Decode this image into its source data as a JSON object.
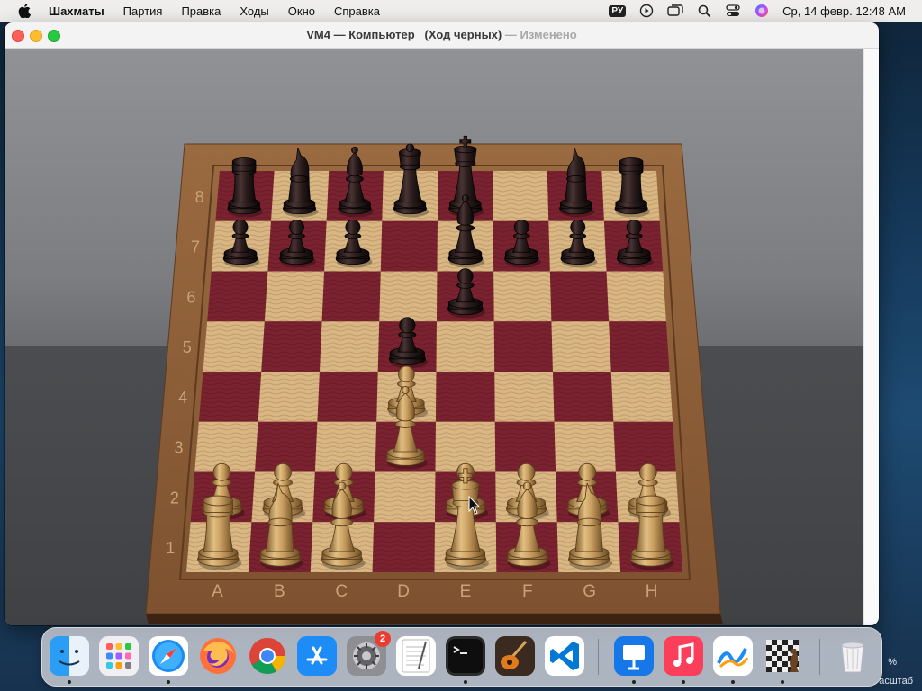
{
  "menubar": {
    "app_name": "Шахматы",
    "items": [
      "Партия",
      "Правка",
      "Ходы",
      "Окно",
      "Справка"
    ],
    "keyboard": "РУ",
    "clock": "Ср, 14 февр.  12:48 AM"
  },
  "window": {
    "title_main": "VM4 — Компьютер",
    "title_turn": "(Ход черных)",
    "title_sep": "—",
    "title_status": "Изменено"
  },
  "board": {
    "files": [
      "A",
      "B",
      "C",
      "D",
      "E",
      "F",
      "G",
      "H"
    ],
    "ranks": [
      "1",
      "2",
      "3",
      "4",
      "5",
      "6",
      "7",
      "8"
    ],
    "colors": {
      "dark_square": "#7a2230",
      "light_square": "#d9b98a",
      "frame": "#8a5a35",
      "white_piece": "#c9a265",
      "black_piece": "#2b1d1e"
    },
    "pieces": [
      {
        "square": "a8",
        "color": "black",
        "type": "rook"
      },
      {
        "square": "b8",
        "color": "black",
        "type": "knight"
      },
      {
        "square": "c8",
        "color": "black",
        "type": "bishop"
      },
      {
        "square": "d8",
        "color": "black",
        "type": "queen"
      },
      {
        "square": "e8",
        "color": "black",
        "type": "king"
      },
      {
        "square": "g8",
        "color": "black",
        "type": "knight"
      },
      {
        "square": "h8",
        "color": "black",
        "type": "rook"
      },
      {
        "square": "a7",
        "color": "black",
        "type": "pawn"
      },
      {
        "square": "b7",
        "color": "black",
        "type": "pawn"
      },
      {
        "square": "c7",
        "color": "black",
        "type": "pawn"
      },
      {
        "square": "e7",
        "color": "black",
        "type": "bishop"
      },
      {
        "square": "f7",
        "color": "black",
        "type": "pawn"
      },
      {
        "square": "g7",
        "color": "black",
        "type": "pawn"
      },
      {
        "square": "h7",
        "color": "black",
        "type": "pawn"
      },
      {
        "square": "e6",
        "color": "black",
        "type": "pawn"
      },
      {
        "square": "d5",
        "color": "black",
        "type": "pawn"
      },
      {
        "square": "d4",
        "color": "white",
        "type": "pawn"
      },
      {
        "square": "d3",
        "color": "white",
        "type": "bishop"
      },
      {
        "square": "a2",
        "color": "white",
        "type": "pawn"
      },
      {
        "square": "b2",
        "color": "white",
        "type": "pawn"
      },
      {
        "square": "c2",
        "color": "white",
        "type": "pawn"
      },
      {
        "square": "e2",
        "color": "white",
        "type": "pawn"
      },
      {
        "square": "f2",
        "color": "white",
        "type": "pawn"
      },
      {
        "square": "g2",
        "color": "white",
        "type": "pawn"
      },
      {
        "square": "h2",
        "color": "white",
        "type": "pawn"
      },
      {
        "square": "a1",
        "color": "white",
        "type": "rook"
      },
      {
        "square": "b1",
        "color": "white",
        "type": "knight"
      },
      {
        "square": "c1",
        "color": "white",
        "type": "bishop"
      },
      {
        "square": "e1",
        "color": "white",
        "type": "king"
      },
      {
        "square": "f1",
        "color": "white",
        "type": "bishop"
      },
      {
        "square": "g1",
        "color": "white",
        "type": "knight"
      },
      {
        "square": "h1",
        "color": "white",
        "type": "rook"
      }
    ]
  },
  "dock": {
    "apps": [
      {
        "name": "finder",
        "running": true
      },
      {
        "name": "launchpad",
        "running": false
      },
      {
        "name": "safari",
        "running": true
      },
      {
        "name": "firefox",
        "running": false
      },
      {
        "name": "chrome",
        "running": false
      },
      {
        "name": "app-store",
        "running": false
      },
      {
        "name": "system-settings",
        "running": false,
        "badge": "2"
      },
      {
        "name": "textedit",
        "running": false
      },
      {
        "name": "terminal",
        "running": true
      },
      {
        "name": "garageband",
        "running": false
      },
      {
        "name": "vscode",
        "running": false
      },
      {
        "name": "keynote",
        "running": true
      },
      {
        "name": "music",
        "running": true
      },
      {
        "name": "freeform",
        "running": true
      },
      {
        "name": "chess",
        "running": true
      },
      {
        "name": "trash",
        "running": false
      }
    ]
  },
  "background_window": {
    "zoom_text": "%",
    "label": "асштаб"
  }
}
